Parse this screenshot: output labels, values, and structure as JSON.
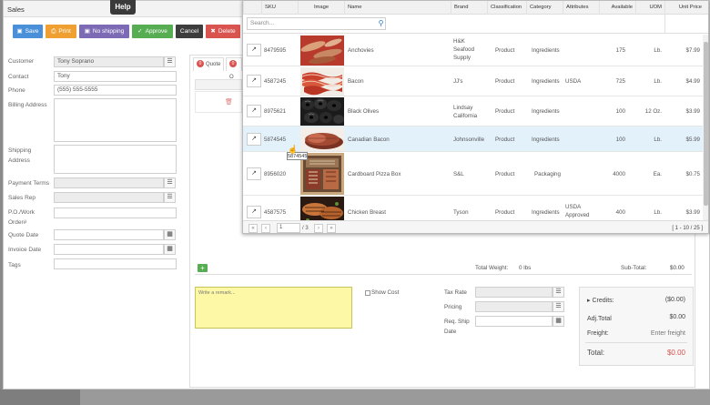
{
  "window": {
    "title": "Sales",
    "help_label": "Help"
  },
  "toolbar": {
    "buttons": [
      {
        "label": "Save",
        "icon": "floppy-icon",
        "color": "#4a90d9"
      },
      {
        "label": "Print",
        "icon": "print-icon",
        "color": "#f0a030"
      },
      {
        "label": "No shipping",
        "icon": "truck-icon",
        "color": "#7d6ab5"
      },
      {
        "label": "Approve",
        "icon": "check-icon",
        "color": "#56ad52"
      },
      {
        "label": "Cancel",
        "icon": "",
        "color": "#3d3d3d"
      },
      {
        "label": "Delete",
        "icon": "x-icon",
        "color": "#d9534f"
      }
    ]
  },
  "form": {
    "customer": {
      "label": "Customer",
      "value": "Tony Soprano"
    },
    "contact": {
      "label": "Contact",
      "value": "Tony"
    },
    "phone": {
      "label": "Phone",
      "value": "(555) 555-5555"
    },
    "billing": {
      "label": "Billing Address",
      "value": ""
    },
    "shipping": {
      "label1": "Shipping",
      "label2": "Address",
      "value": ""
    },
    "payment_terms": {
      "label": "Payment Terms",
      "value": ""
    },
    "sales_rep": {
      "label": "Sales Rep",
      "value": ""
    },
    "po": {
      "label1": "P.O./Work",
      "label2": "Order#",
      "value": ""
    },
    "quote_date": {
      "label": "Quote Date",
      "value": ""
    },
    "invoice_date": {
      "label": "Invoice Date",
      "value": ""
    },
    "tags": {
      "label": "Tags",
      "value": ""
    }
  },
  "tabs": [
    {
      "badge": "0",
      "label": "Quote"
    },
    {
      "badge": "0",
      "label": "O"
    }
  ],
  "totals_bar": {
    "total_weight_label": "Total Weight:",
    "total_weight_value": "0 lbs",
    "subtotal_label": "Sub-Total:",
    "subtotal_value": "$0.00"
  },
  "remark": {
    "placeholder": "Write a remark..."
  },
  "show_cost": {
    "label": "Show Cost"
  },
  "mid_fields": {
    "tax_rate": "Tax Rate",
    "pricing": "Pricing",
    "req_ship_1": "Req. Ship",
    "req_ship_2": "Date"
  },
  "summary": {
    "credits_label": "Credits:",
    "credits_value": "($0.00)",
    "adj_total_label": "Adj.Total",
    "adj_total_value": "$0.00",
    "freight_label": "Freight:",
    "freight_value": "Enter freight",
    "total_label": "Total:",
    "total_value": "$0.00",
    "total_color": "#d9534f"
  },
  "product_grid": {
    "columns": [
      "SKU",
      "Image",
      "Name",
      "Brand",
      "Classification",
      "Category",
      "Attributes",
      "Available",
      "UOM",
      "Unit Price"
    ],
    "search_placeholder": "Search...",
    "rows": [
      {
        "sku": "8479595",
        "name": "Anchovies",
        "brand": "H&K Seafood Supply",
        "classification": "Product",
        "category": "Ingredients",
        "attributes": "",
        "available": "175",
        "uom": "Lb.",
        "price": "$7.99"
      },
      {
        "sku": "4587245",
        "name": "Bacon",
        "brand": "JJ's",
        "classification": "Product",
        "category": "Ingredients",
        "attributes": "USDA",
        "available": "725",
        "uom": "Lb.",
        "price": "$4.99"
      },
      {
        "sku": "8975621",
        "name": "Black Olives",
        "brand": "Lindsay California",
        "classification": "Product",
        "category": "Ingredients",
        "attributes": "",
        "available": "100",
        "uom": "12 Oz.",
        "price": "$3.99"
      },
      {
        "sku": "5874545",
        "name": "Canadian Bacon",
        "brand": "Johnsonville",
        "classification": "Product",
        "category": "Ingredients",
        "attributes": "",
        "available": "100",
        "uom": "Lb.",
        "price": "$5.99"
      },
      {
        "sku": "8956020",
        "name": "Cardboard Pizza Box",
        "brand": "S&L",
        "classification": "Product",
        "category": "Packaging",
        "attributes": "",
        "available": "4000",
        "uom": "Ea.",
        "price": "$0.75"
      },
      {
        "sku": "4587575",
        "name": "Chicken Breast",
        "brand": "Tyson",
        "classification": "Product",
        "category": "Ingredients",
        "attributes": "USDA Approved",
        "available": "400",
        "uom": "Lb.",
        "price": "$3.99"
      }
    ],
    "pager": {
      "page": "1",
      "of_pages": "/ 3",
      "range": "[ 1 - 10 / 25 ]"
    },
    "tooltip": "5874545"
  }
}
